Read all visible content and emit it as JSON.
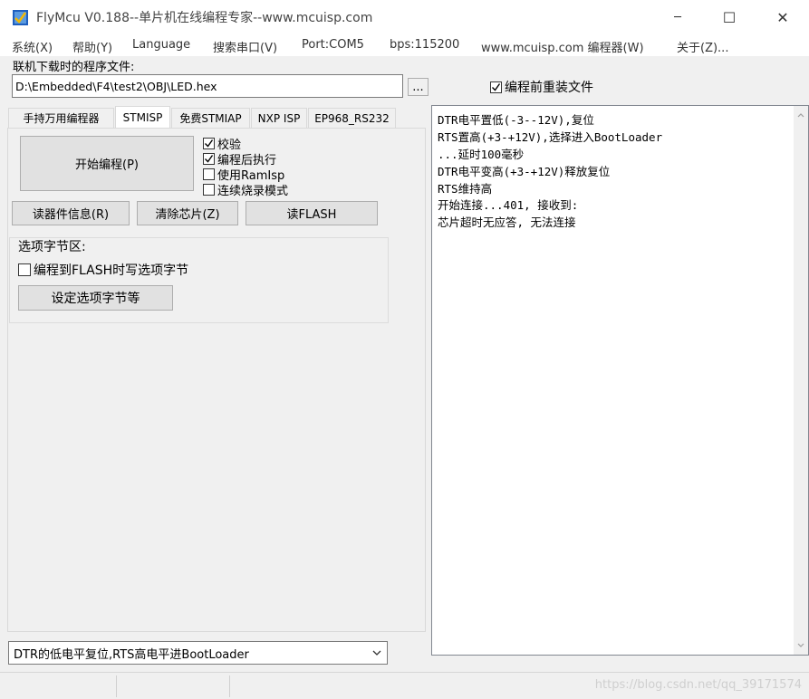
{
  "window": {
    "title": "FlyMcu V0.188--单片机在线编程专家--www.mcuisp.com",
    "minimize": "─",
    "maximize": "☐",
    "close": "✕"
  },
  "menu": [
    "系统(X)",
    "帮助(Y)",
    "Language",
    "搜索串口(V)",
    "Port:COM5",
    "bps:115200",
    "www.mcuisp.com 编程器(W)",
    "关于(Z)..."
  ],
  "file": {
    "label": "联机下载时的程序文件:",
    "path": "D:\\Embedded\\F4\\test2\\OBJ\\LED.hex",
    "browse": "...",
    "reload_label": "编程前重装文件",
    "reload_checked": true
  },
  "tabs": [
    "手持万用编程器",
    "STMISP",
    "免费STMIAP",
    "NXP ISP",
    "EP968_RS232"
  ],
  "active_tab": "STMISP",
  "stmisp": {
    "start_button": "开始编程(P)",
    "options": [
      {
        "label": "校验",
        "checked": true
      },
      {
        "label": "编程后执行",
        "checked": true
      },
      {
        "label": "使用RamIsp",
        "checked": false
      },
      {
        "label": "连续烧录模式",
        "checked": false
      }
    ],
    "read_info_button": "读器件信息(R)",
    "erase_button": "清除芯片(Z)",
    "read_flash_button": "读FLASH",
    "option_group_title": "选项字节区:",
    "option_write_label": "编程到FLASH时写选项字节",
    "option_write_checked": false,
    "option_set_button": "设定选项字节等"
  },
  "reset_mode": {
    "selected": "DTR的低电平复位,RTS高电平进BootLoader"
  },
  "log": {
    "lines": [
      "DTR电平置低(-3--12V),复位",
      "RTS置高(+3-+12V),选择进入BootLoader",
      "...延时100毫秒",
      "DTR电平变高(+3-+12V)释放复位",
      "RTS维持高",
      "开始连接...401, 接收到:",
      "芯片超时无应答, 无法连接"
    ]
  },
  "watermark": "https://blog.csdn.net/qq_39171574",
  "colors": {
    "icon_blue": "#1e5fbf",
    "face": "#f0f0f0",
    "button": "#e1e1e1"
  }
}
